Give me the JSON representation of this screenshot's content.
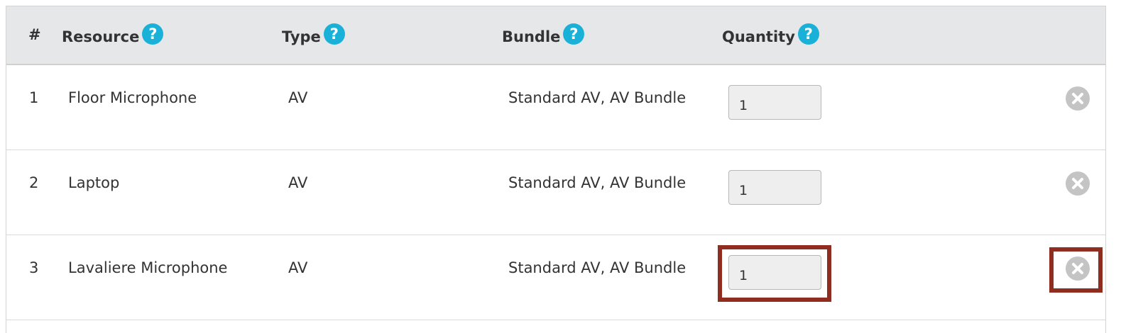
{
  "table": {
    "headers": {
      "index": "#",
      "resource": "Resource",
      "type": "Type",
      "bundle": "Bundle",
      "quantity": "Quantity",
      "help_glyph": "?"
    },
    "rows": [
      {
        "index": "1",
        "resource": "Floor Microphone",
        "type": "AV",
        "bundle": "Standard AV, AV Bundle",
        "quantity": "1"
      },
      {
        "index": "2",
        "resource": "Laptop",
        "type": "AV",
        "bundle": "Standard AV, AV Bundle",
        "quantity": "1"
      },
      {
        "index": "3",
        "resource": "Lavaliere Microphone",
        "type": "AV",
        "bundle": "Standard AV, AV Bundle",
        "quantity": "1"
      }
    ]
  },
  "icons": {
    "help": "question-circle-icon",
    "remove": "close-circle-icon"
  },
  "colors": {
    "header_bg": "#e6e7e9",
    "help_icon": "#1ab1d9",
    "remove_icon": "#c4c4c4",
    "highlight": "#8f2e20",
    "input_bg": "#eeeeee"
  }
}
